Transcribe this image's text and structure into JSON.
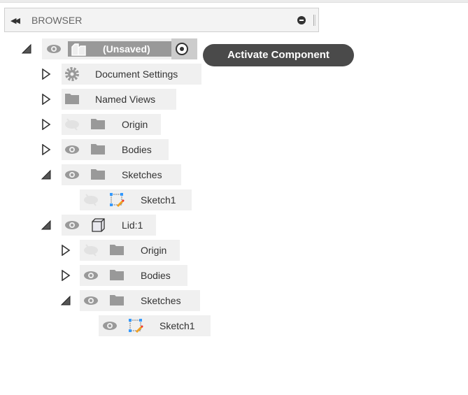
{
  "header": {
    "title": "BROWSER",
    "collapse_icon": "double-left-arrow",
    "minimize_icon": "minus-circle"
  },
  "tooltip": "Activate Component",
  "tree": [
    {
      "label": "(Unsaved)",
      "expanded": true,
      "visible": true,
      "icon": "component-icon",
      "active_radio": true
    },
    {
      "label": "Document Settings",
      "expanded": false,
      "icon": "gear-icon"
    },
    {
      "label": "Named Views",
      "expanded": false,
      "icon": "folder-icon"
    },
    {
      "label": "Origin",
      "expanded": false,
      "visible": false,
      "icon": "folder-icon"
    },
    {
      "label": "Bodies",
      "expanded": false,
      "visible": true,
      "icon": "folder-icon"
    },
    {
      "label": "Sketches",
      "expanded": true,
      "visible": true,
      "icon": "folder-icon"
    },
    {
      "label": "Sketch1",
      "visible": false,
      "icon": "sketch-icon"
    },
    {
      "label": "Lid:1",
      "expanded": true,
      "visible": true,
      "icon": "body-icon"
    },
    {
      "label": "Origin",
      "expanded": false,
      "visible": false,
      "icon": "folder-icon"
    },
    {
      "label": "Bodies",
      "expanded": false,
      "visible": true,
      "icon": "folder-icon"
    },
    {
      "label": "Sketches",
      "expanded": true,
      "visible": true,
      "icon": "folder-icon"
    },
    {
      "label": "Sketch1",
      "visible": true,
      "icon": "sketch-icon"
    }
  ]
}
